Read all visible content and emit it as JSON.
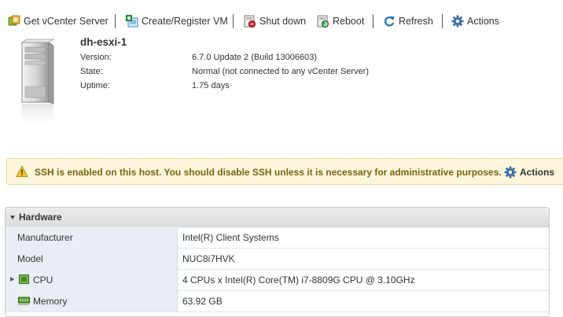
{
  "toolbar": {
    "get_vcenter": "Get vCenter Server",
    "create_register_vm": "Create/Register VM",
    "shut_down": "Shut down",
    "reboot": "Reboot",
    "refresh": "Refresh",
    "actions": "Actions"
  },
  "host": {
    "name": "dh-esxi-1",
    "version_label": "Version:",
    "version_value": "6.7.0 Update 2 (Build 13006603)",
    "state_label": "State:",
    "state_value": "Normal (not connected to any vCenter Server)",
    "uptime_label": "Uptime:",
    "uptime_value": "1.75 days"
  },
  "warning": {
    "message": "SSH is enabled on this host. You should disable SSH unless it is necessary for administrative purposes.",
    "actions_label": "Actions"
  },
  "hardware": {
    "title": "Hardware",
    "rows": [
      {
        "label": "Manufacturer",
        "value": "Intel(R) Client Systems"
      },
      {
        "label": "Model",
        "value": "NUC8i7HVK"
      },
      {
        "label": "CPU",
        "value": "4 CPUs x Intel(R) Core(TM) i7-8809G CPU @ 3.10GHz"
      },
      {
        "label": "Memory",
        "value": "63.92 GB"
      }
    ]
  },
  "colors": {
    "warning_bg": "#fdf6dd",
    "warning_text": "#7a6410",
    "refresh_blue": "#1b75bb",
    "shutdown_red": "#d9262b",
    "hw_label_bg": "#e8eef3"
  },
  "icons": {
    "get_vcenter": "vcenter-icon",
    "create_vm": "create-vm-icon",
    "shut_down": "power-off-icon",
    "reboot": "reboot-icon",
    "refresh": "refresh-icon",
    "actions": "gear-icon",
    "warning": "warning-triangle-icon",
    "cpu": "cpu-chip-icon",
    "memory": "memory-module-icon"
  }
}
